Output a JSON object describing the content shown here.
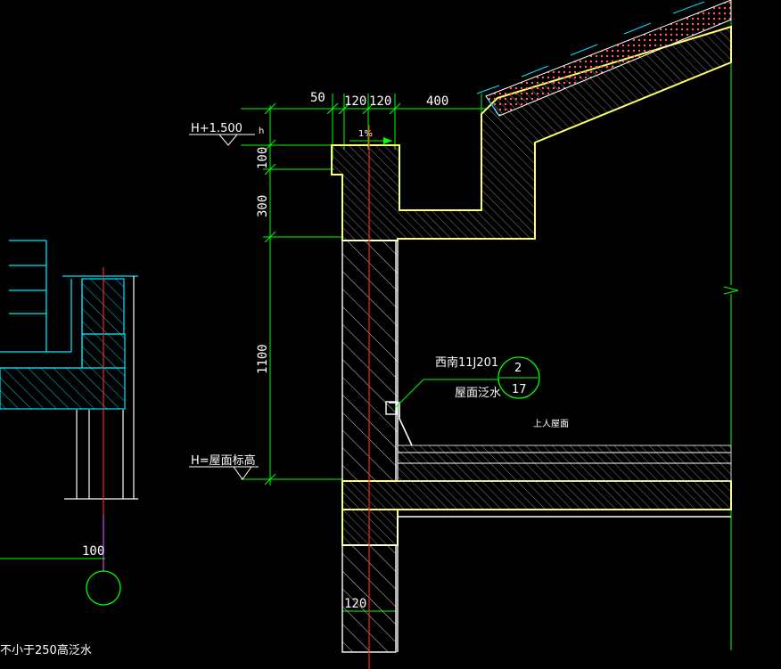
{
  "drawing": {
    "dimensions": {
      "d50": "50",
      "d120a": "120",
      "d120b": "120",
      "d400": "400",
      "d100": "100",
      "d300": "300",
      "d1100": "1100",
      "d100_bottom": "100",
      "d120_bottom": "120"
    },
    "elevations": {
      "top": "H+1.500",
      "h_mark": "h",
      "slope": "1%",
      "roof": "H=屋面标高"
    },
    "callout": {
      "reference": "西南11J201",
      "detail_number": "2",
      "sheet_number": "17",
      "description": "屋面泛水"
    },
    "notes": {
      "roof_use": "上人屋面",
      "bottom_left": "不小于250高泛水"
    },
    "colors": {
      "background": "#000000",
      "dimension": "#00ff00",
      "outline": "#ffff66",
      "axis": "#ff2020",
      "hatch": "#cccccc",
      "text": "#ffffff",
      "cyan": "#00e5ff"
    }
  }
}
